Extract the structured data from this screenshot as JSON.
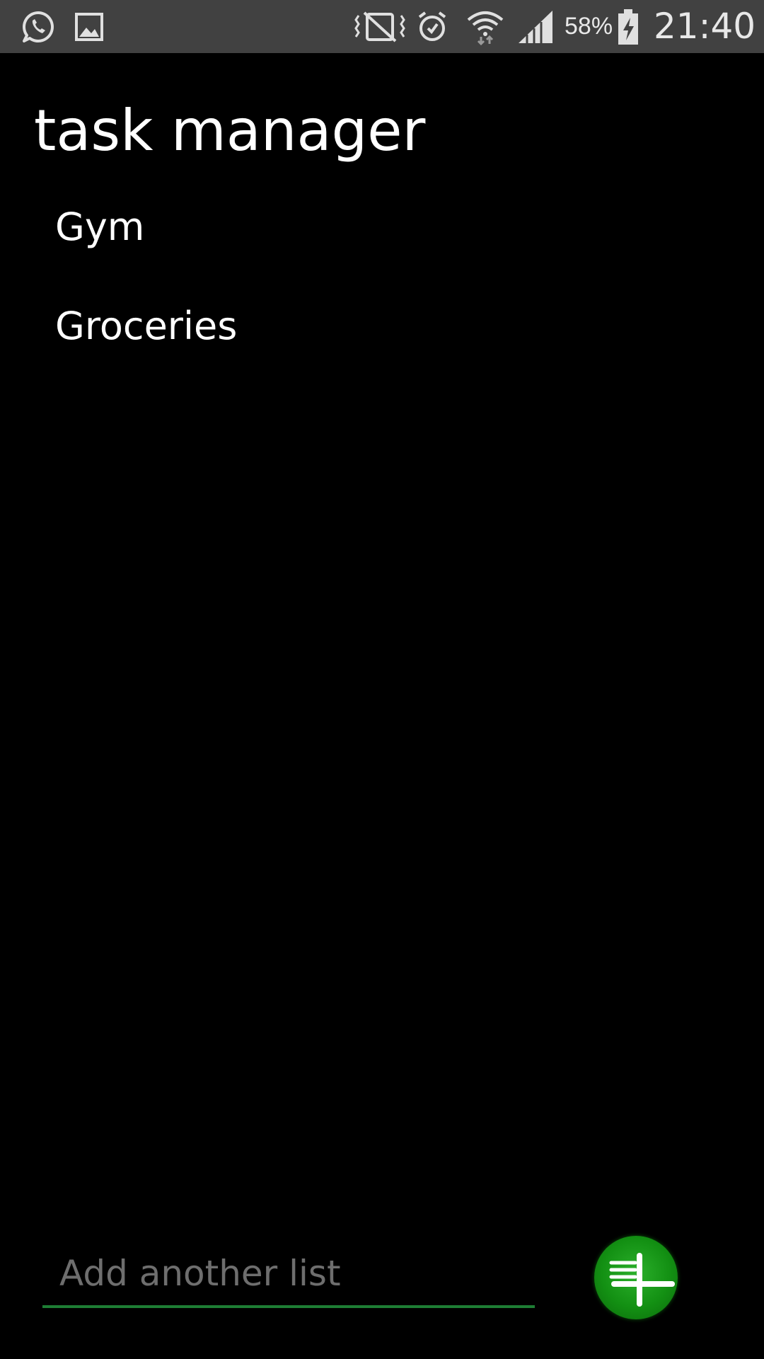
{
  "status_bar": {
    "battery_percent": "58%",
    "time": "21:40",
    "icons": [
      "whatsapp-icon",
      "gallery-icon",
      "vibrate-mute-icon",
      "alarm-icon",
      "wifi-icon",
      "signal-icon",
      "battery-charging-icon"
    ]
  },
  "app": {
    "title": "task manager"
  },
  "lists": [
    {
      "label": "Gym"
    },
    {
      "label": "Groceries"
    }
  ],
  "new_list": {
    "placeholder": "Add another list",
    "value": ""
  },
  "colors": {
    "background": "#000000",
    "status_bar": "#414141",
    "accent_green": "#1e7d34",
    "button_green": "#139013",
    "placeholder": "#6e6e6e"
  }
}
